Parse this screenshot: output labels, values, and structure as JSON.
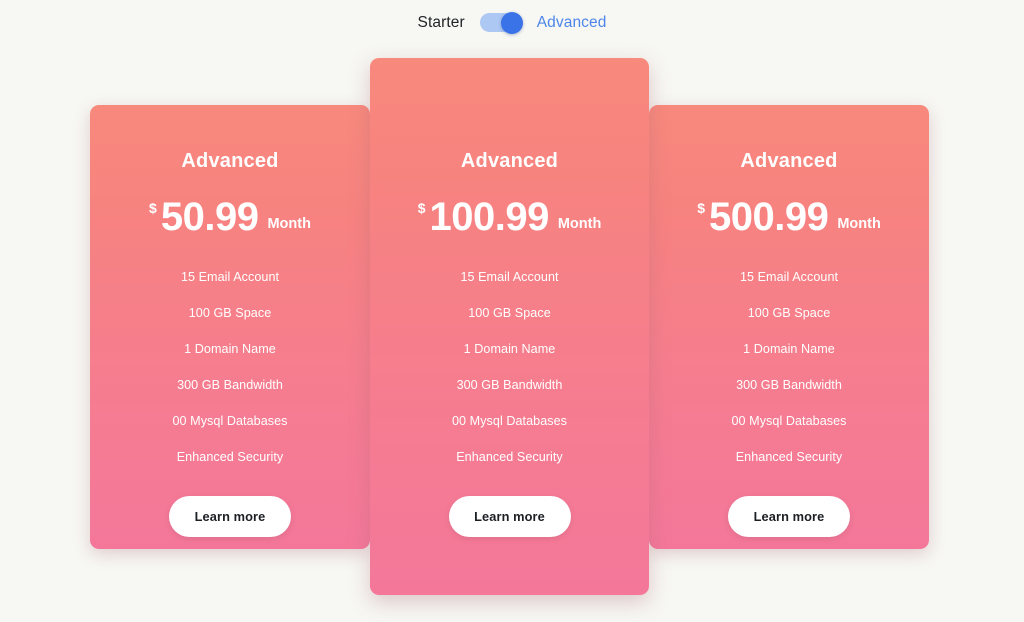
{
  "toggle": {
    "left_label": "Starter",
    "right_label": "Advanced",
    "state": "Advanced",
    "track_color": "#aec8f4",
    "knob_color": "#3a72e8",
    "active_label_color": "#4d86e8",
    "inactive_label_color": "#222428"
  },
  "theme": {
    "page_background": "#f7f7f3",
    "card_gradient_start": "#f8897d",
    "card_gradient_end": "#f4779a",
    "card_text_color": "#ffffff",
    "button_background": "#ffffff",
    "button_text_color": "#1c1f24"
  },
  "plans": [
    {
      "title": "Advanced",
      "currency": "$",
      "amount": "50.99",
      "period": "Month",
      "features": [
        "15 Email Account",
        "100 GB Space",
        "1 Domain Name",
        "300 GB Bandwidth",
        "00 Mysql Databases",
        "Enhanced Security"
      ],
      "cta": "Learn more"
    },
    {
      "title": "Advanced",
      "currency": "$",
      "amount": "100.99",
      "period": "Month",
      "features": [
        "15 Email Account",
        "100 GB Space",
        "1 Domain Name",
        "300 GB Bandwidth",
        "00 Mysql Databases",
        "Enhanced Security"
      ],
      "cta": "Learn more"
    },
    {
      "title": "Advanced",
      "currency": "$",
      "amount": "500.99",
      "period": "Month",
      "features": [
        "15 Email Account",
        "100 GB Space",
        "1 Domain Name",
        "300 GB Bandwidth",
        "00 Mysql Databases",
        "Enhanced Security"
      ],
      "cta": "Learn more"
    }
  ]
}
